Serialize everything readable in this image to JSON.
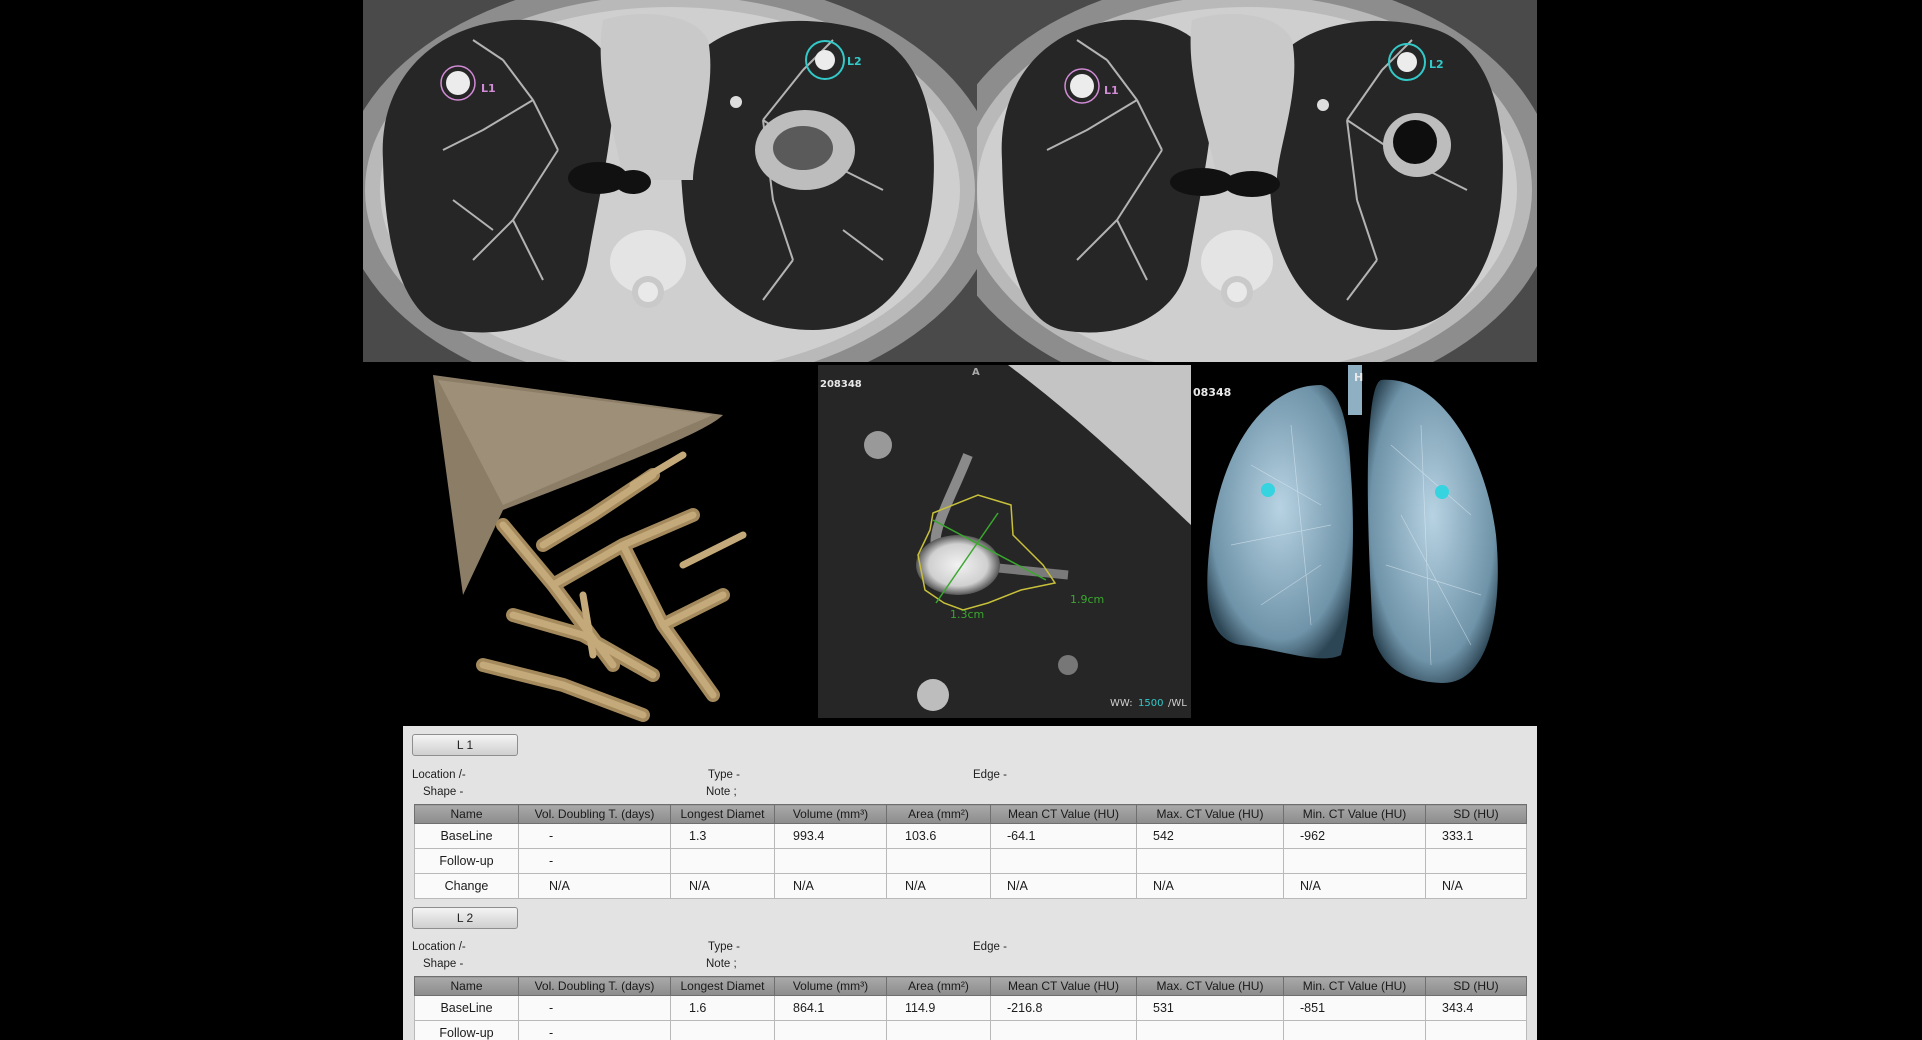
{
  "colors": {
    "l1_marker": "#d28bd6",
    "l2_marker": "#33c9c9",
    "nodule_outline": "#c8c03a",
    "measure_line": "#3aa82e"
  },
  "axial_left": {
    "marker_l1": "L1",
    "marker_l2": "L2"
  },
  "axial_right": {
    "marker_l1": "L1",
    "marker_l2": "L2"
  },
  "zoom_view": {
    "series_id": "208348",
    "orientation": "A",
    "diam_a": "1.3cm",
    "diam_b": "1.9cm",
    "ww_label": "WW:",
    "ww_value": "1500",
    "wl_label": "/WL"
  },
  "volume_view": {
    "series_id": "08348",
    "lesion_label": "H"
  },
  "lesions": [
    {
      "tab": "L 1",
      "location_label": "Location",
      "location_value": "/-",
      "type_label": "Type",
      "type_value": "-",
      "edge_label": "Edge",
      "edge_value": "-",
      "shape_label": "Shape",
      "shape_value": "-",
      "note_label": "Note",
      "note_value": ";",
      "columns": [
        "Name",
        "Vol. Doubling T. (days)",
        "Longest Diamet",
        "Volume (mm³)",
        "Area (mm²)",
        "Mean CT Value (HU)",
        "Max. CT Value (HU)",
        "Min. CT Value (HU)",
        "SD (HU)"
      ],
      "rows": [
        [
          "BaseLine",
          "-",
          "1.3",
          "993.4",
          "103.6",
          "-64.1",
          "542",
          "-962",
          "333.1"
        ],
        [
          "Follow-up",
          "-",
          "",
          "",
          "",
          "",
          "",
          "",
          ""
        ],
        [
          "Change",
          "N/A",
          "N/A",
          "N/A",
          "N/A",
          "N/A",
          "N/A",
          "N/A",
          "N/A"
        ]
      ]
    },
    {
      "tab": "L 2",
      "location_label": "Location",
      "location_value": "/-",
      "type_label": "Type",
      "type_value": "-",
      "edge_label": "Edge",
      "edge_value": "-",
      "shape_label": "Shape",
      "shape_value": "-",
      "note_label": "Note",
      "note_value": ";",
      "columns": [
        "Name",
        "Vol. Doubling T. (days)",
        "Longest Diamet",
        "Volume (mm³)",
        "Area (mm²)",
        "Mean CT Value (HU)",
        "Max. CT Value (HU)",
        "Min. CT Value (HU)",
        "SD (HU)"
      ],
      "rows": [
        [
          "BaseLine",
          "-",
          "1.6",
          "864.1",
          "114.9",
          "-216.8",
          "531",
          "-851",
          "343.4"
        ],
        [
          "Follow-up",
          "-",
          "",
          "",
          "",
          "",
          "",
          "",
          ""
        ]
      ]
    }
  ]
}
